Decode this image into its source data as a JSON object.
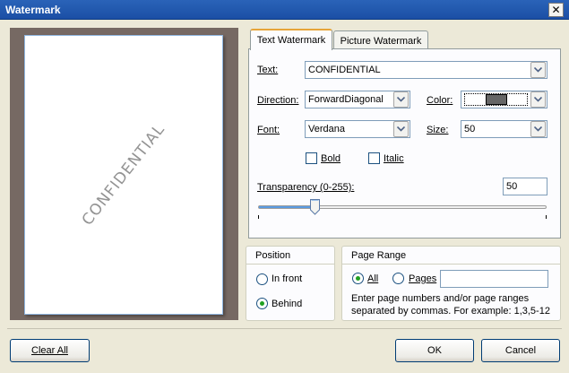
{
  "window": {
    "title": "Watermark",
    "close_glyph": "✕"
  },
  "preview": {
    "watermark_text": "CONFIDENTIAL"
  },
  "tabs": [
    {
      "label": "Text Watermark",
      "active": true
    },
    {
      "label": "Picture Watermark",
      "active": false
    }
  ],
  "form": {
    "text_label": "Text:",
    "text_value": "CONFIDENTIAL",
    "direction_label": "Direction:",
    "direction_value": "ForwardDiagonal",
    "color_label": "Color:",
    "color_value": "#666666",
    "font_label": "Font:",
    "font_value": "Verdana",
    "size_label": "Size:",
    "size_value": "50",
    "bold_label": "Bold",
    "bold_checked": false,
    "italic_label": "Italic",
    "italic_checked": false,
    "transparency_label": "Transparency (0-255):",
    "transparency_value": "50",
    "transparency_max": 255
  },
  "position": {
    "title": "Position",
    "options": [
      {
        "label": "In front",
        "selected": false
      },
      {
        "label": "Behind",
        "selected": true
      }
    ]
  },
  "page_range": {
    "title": "Page Range",
    "all_label": "All",
    "all_selected": true,
    "pages_label": "Pages",
    "pages_value": "",
    "help_line1": "Enter page numbers and/or page ranges",
    "help_line2": "separated by commas. For example: 1,3,5-12"
  },
  "buttons": {
    "clear_all": "Clear All",
    "ok": "OK",
    "cancel": "Cancel"
  },
  "colors": {
    "titlebar": "#2a63b8",
    "dialog_bg": "#ece9d8",
    "tab_highlight": "#e7a53a",
    "radio_dot": "#21a121"
  }
}
